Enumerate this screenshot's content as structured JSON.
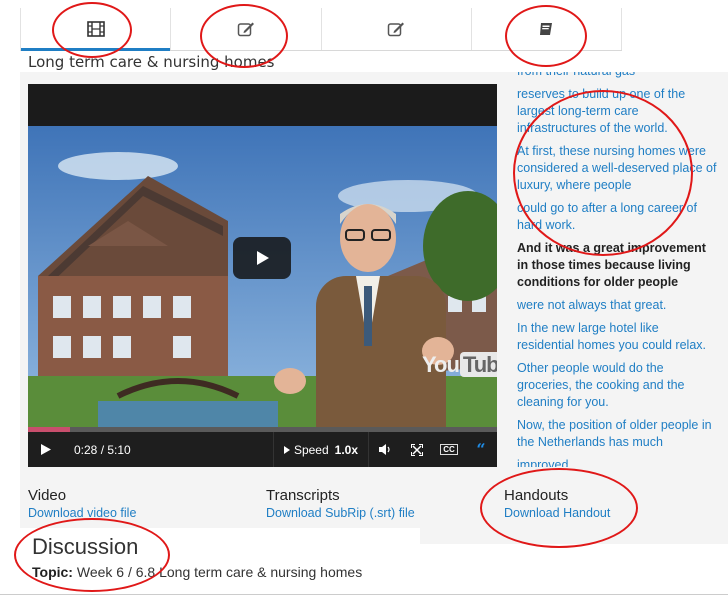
{
  "tabs": [
    {
      "icon": "film-icon",
      "active": true
    },
    {
      "icon": "edit-icon",
      "active": false
    },
    {
      "icon": "edit-icon",
      "active": false
    },
    {
      "icon": "book-icon",
      "active": false
    }
  ],
  "page_title": "Long term care & nursing homes",
  "video": {
    "time": "0:28 / 5:10",
    "speed_label": "Speed",
    "speed_value": "1.0x",
    "progress": 0.09,
    "brand_you": "You",
    "brand_tube": "Tube"
  },
  "transcript": [
    {
      "text": "from their natural gas",
      "current": false
    },
    {
      "text": "reserves to build up one of the largest long-term care infrastructures of the world.",
      "current": false
    },
    {
      "text": "At first, these nursing homes were considered a well-deserved place of luxury, where people",
      "current": false
    },
    {
      "text": "could go to after a long career of hard work.",
      "current": false
    },
    {
      "text": "And it was a great improvement in those times because living conditions for older people",
      "current": true
    },
    {
      "text": "were not always that great.",
      "current": false
    },
    {
      "text": "In the new large hotel like residential homes you could relax.",
      "current": false
    },
    {
      "text": "Other people would do the groceries, the cooking and the cleaning for you.",
      "current": false
    },
    {
      "text": "Now, the position of older people in the Netherlands has much",
      "current": false
    },
    {
      "text": "improved.",
      "current": false
    }
  ],
  "downloads": {
    "video_heading": "Video",
    "video_link": "Download video file",
    "transcripts_heading": "Transcripts",
    "transcripts_link": "Download SubRip (.srt) file",
    "handouts_heading": "Handouts",
    "handouts_link": "Download Handout"
  },
  "discussion": {
    "title": "Discussion",
    "topic_label": "Topic:",
    "topic_value": "Week 6 / 6.8 Long term care & nursing homes"
  },
  "colors": {
    "accent": "#1f7ec4",
    "annotation": "#e01818",
    "progress": "#c94f6d"
  }
}
